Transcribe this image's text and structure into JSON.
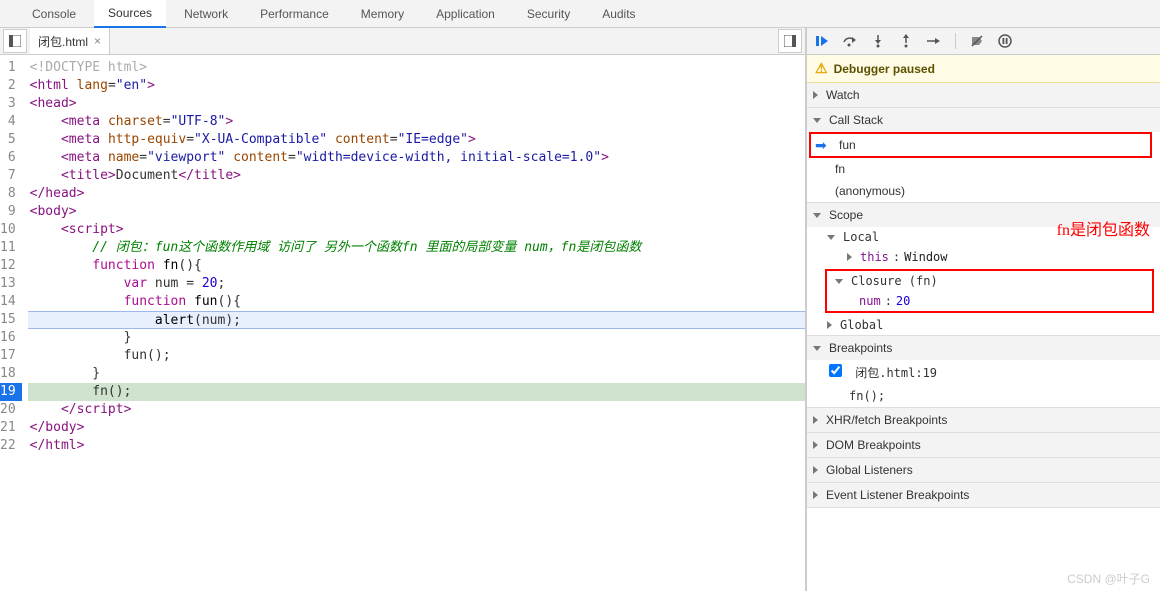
{
  "tabs": [
    "Console",
    "Sources",
    "Network",
    "Performance",
    "Memory",
    "Application",
    "Security",
    "Audits"
  ],
  "activeTab": "Sources",
  "fileTab": {
    "name": "闭包.html"
  },
  "code": {
    "lines": [
      {
        "n": 1,
        "html": "<span class='c-gray'>&lt;!DOCTYPE html&gt;</span>"
      },
      {
        "n": 2,
        "html": "<span class='c-tag'>&lt;html</span> <span class='c-attr'>lang</span>=<span class='c-str'>\"en\"</span><span class='c-tag'>&gt;</span>"
      },
      {
        "n": 3,
        "html": "<span class='c-tag'>&lt;head&gt;</span>"
      },
      {
        "n": 4,
        "html": "    <span class='c-tag'>&lt;meta</span> <span class='c-attr'>charset</span>=<span class='c-str'>\"UTF-8\"</span><span class='c-tag'>&gt;</span>"
      },
      {
        "n": 5,
        "html": "    <span class='c-tag'>&lt;meta</span> <span class='c-attr'>http-equiv</span>=<span class='c-str'>\"X-UA-Compatible\"</span> <span class='c-attr'>content</span>=<span class='c-str'>\"IE=edge\"</span><span class='c-tag'>&gt;</span>"
      },
      {
        "n": 6,
        "html": "    <span class='c-tag'>&lt;meta</span> <span class='c-attr'>name</span>=<span class='c-str'>\"viewport\"</span> <span class='c-attr'>content</span>=<span class='c-str'>\"width=device-width, initial-scale=1.0\"</span><span class='c-tag'>&gt;</span>"
      },
      {
        "n": 7,
        "html": "    <span class='c-tag'>&lt;title&gt;</span>Document<span class='c-tag'>&lt;/title&gt;</span>"
      },
      {
        "n": 8,
        "html": "<span class='c-tag'>&lt;/head&gt;</span>"
      },
      {
        "n": 9,
        "html": "<span class='c-tag'>&lt;body&gt;</span>"
      },
      {
        "n": 10,
        "html": "    <span class='c-tag'>&lt;script&gt;</span>"
      },
      {
        "n": 11,
        "html": "        <span class='c-cmt'>// 闭包：fun这个函数作用域 访问了 另外一个函数fn 里面的局部变量 num，fn是闭包函数</span>"
      },
      {
        "n": 12,
        "html": "        <span class='c-kw'>function</span> <span class='c-fn'>fn</span>(){"
      },
      {
        "n": 13,
        "html": "            <span class='c-kw'>var</span> num = <span class='c-num'>20</span>;"
      },
      {
        "n": 14,
        "html": "            <span class='c-kw'>function</span> <span class='c-fn'>fun</span>(){"
      },
      {
        "n": 15,
        "html": "                <span class='c-fn'>alert</span>(num);",
        "hl": true
      },
      {
        "n": 16,
        "html": "            }"
      },
      {
        "n": 17,
        "html": "            fun();"
      },
      {
        "n": 18,
        "html": "        }"
      },
      {
        "n": 19,
        "html": "        fn();",
        "current": true
      },
      {
        "n": 20,
        "html": "    <span class='c-tag'>&lt;/script&gt;</span>"
      },
      {
        "n": 21,
        "html": "<span class='c-tag'>&lt;/body&gt;</span>"
      },
      {
        "n": 22,
        "html": "<span class='c-tag'>&lt;/html&gt;</span>"
      }
    ]
  },
  "debugger": {
    "pausedText": "Debugger paused",
    "sections": {
      "watch": "Watch",
      "callStack": "Call Stack",
      "scope": "Scope",
      "breakpoints": "Breakpoints",
      "xhr": "XHR/fetch Breakpoints",
      "dom": "DOM Breakpoints",
      "global": "Global Listeners",
      "event": "Event Listener Breakpoints"
    },
    "callStack": [
      {
        "name": "fun",
        "active": true
      },
      {
        "name": "fn"
      },
      {
        "name": "(anonymous)"
      }
    ],
    "scope": {
      "local": {
        "label": "Local",
        "this": "this",
        "thisVal": "Window"
      },
      "closure": {
        "label": "Closure (fn)",
        "key": "num",
        "val": "20"
      },
      "global": {
        "label": "Global"
      }
    },
    "breakpoint": {
      "label": "闭包.html:19",
      "code": "fn();"
    }
  },
  "annotation": "fn是闭包函数",
  "watermark": "CSDN @叶子G"
}
